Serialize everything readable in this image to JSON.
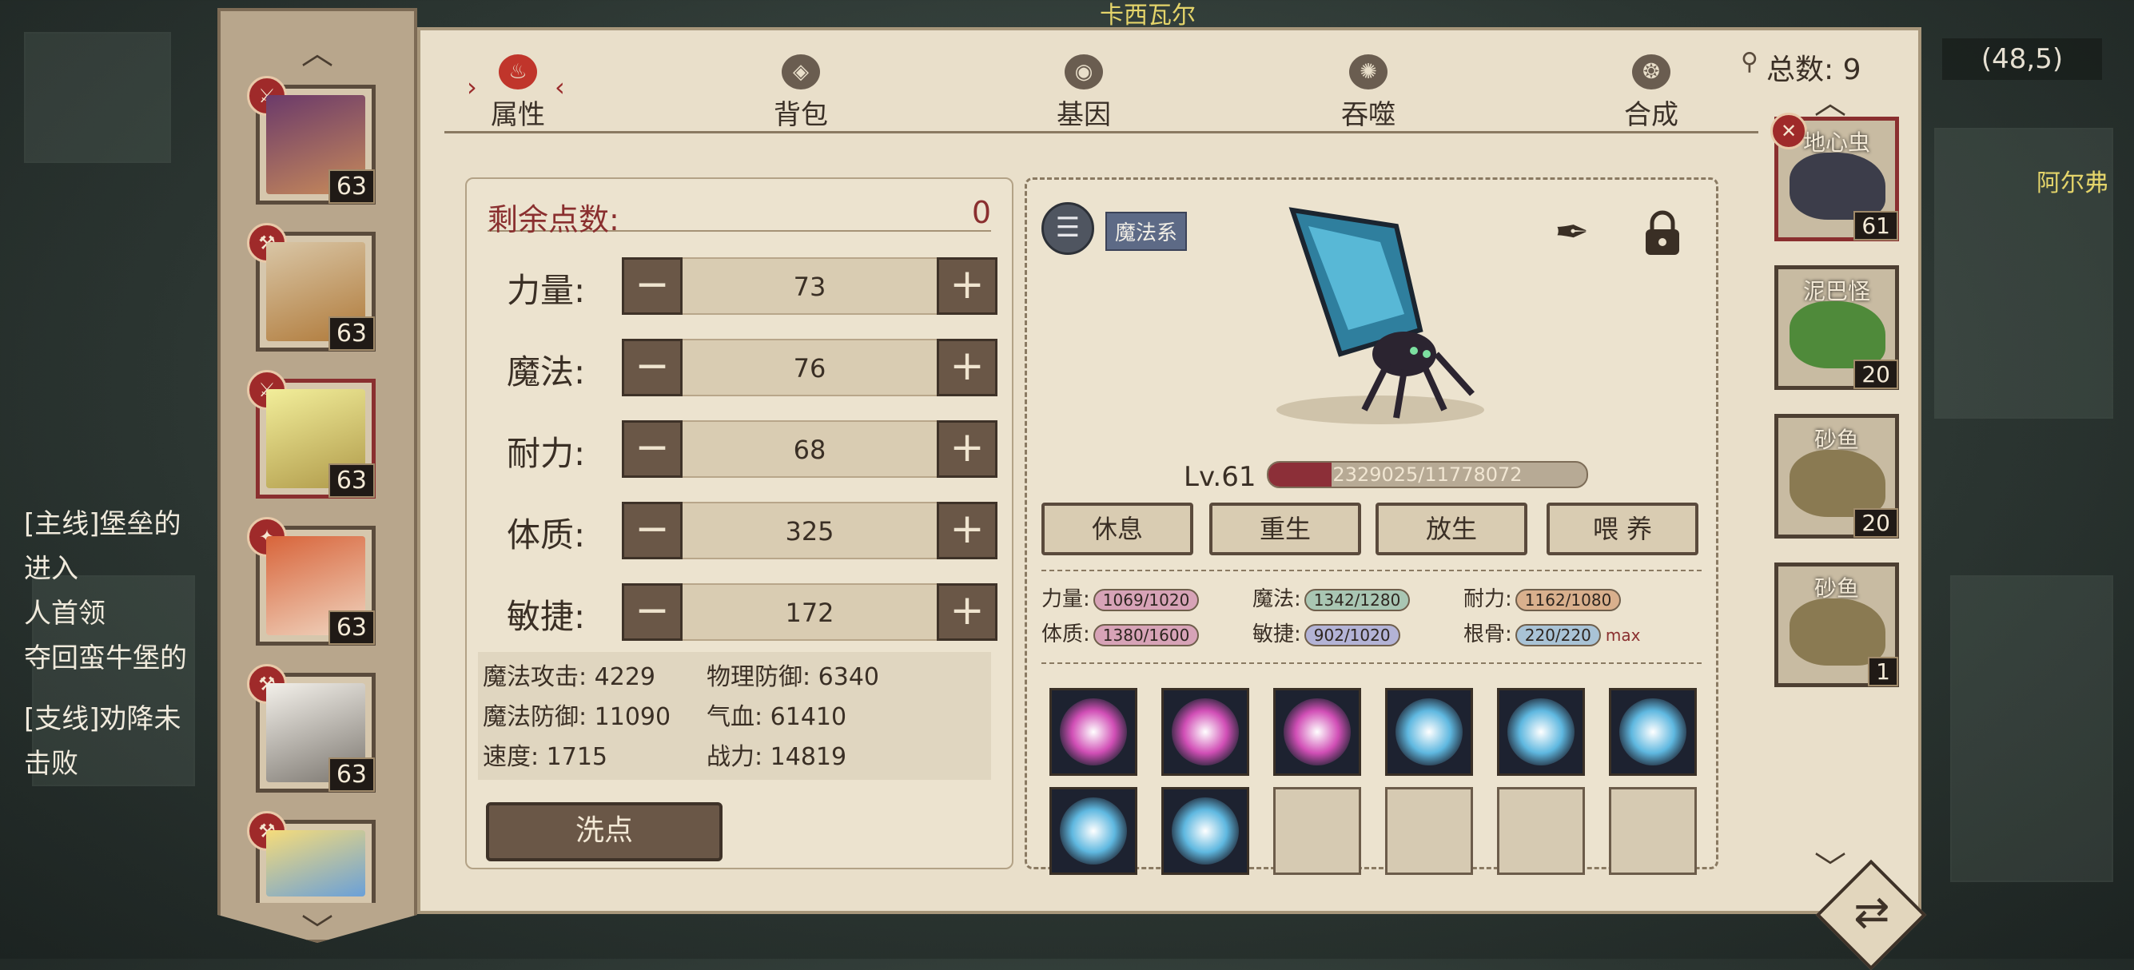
{
  "background": {
    "top_name": "卡西瓦尔",
    "right_name": "阿尔弗",
    "chat_lines": [
      "[主线]堡垒的",
      "进入",
      "人首领",
      "夺回蛮牛堡的",
      "[支线]劝降未",
      "击败"
    ]
  },
  "header": {
    "total_label": "总数: 9",
    "coords": "(48,5)"
  },
  "tabs": [
    {
      "label": "属性",
      "icon": "flame-icon",
      "active": true
    },
    {
      "label": "背包",
      "icon": "bag-icon",
      "active": false
    },
    {
      "label": "基因",
      "icon": "gene-icon",
      "active": false
    },
    {
      "label": "吞噬",
      "icon": "devour-icon",
      "active": false
    },
    {
      "label": "合成",
      "icon": "fuse-icon",
      "active": false
    }
  ],
  "characters": [
    {
      "level": "63",
      "selected": false,
      "color": "#6b3a6a"
    },
    {
      "level": "63",
      "selected": false,
      "color": "#b07a3a"
    },
    {
      "level": "63",
      "selected": true,
      "color": "#e3d04a"
    },
    {
      "level": "63",
      "selected": false,
      "color": "#d8643a"
    },
    {
      "level": "63",
      "selected": false,
      "color": "#c9c4bc"
    },
    {
      "level": "",
      "selected": false,
      "color": "#e6c34a"
    }
  ],
  "points": {
    "label": "剩余点数:",
    "value": "0",
    "stats": [
      {
        "name": "力量:",
        "value": "73"
      },
      {
        "name": "魔法:",
        "value": "76"
      },
      {
        "name": "耐力:",
        "value": "68"
      },
      {
        "name": "体质:",
        "value": "325"
      },
      {
        "name": "敏捷:",
        "value": "172"
      }
    ],
    "derived": [
      "魔法攻击: 4229",
      "物理防御: 6340",
      "魔法防御: 11090",
      "气血: 61410",
      "速度: 1715",
      "战力: 14819"
    ],
    "reset_label": "洗点"
  },
  "pet": {
    "element": "魔法系",
    "level": "Lv.61",
    "exp_text": "2329025/11778072",
    "exp_fraction": 0.198,
    "actions": [
      "休息",
      "重生",
      "放生",
      "喂 养"
    ],
    "aptitudes": [
      {
        "name": "力量:",
        "value": "1069/1020",
        "color": "#d7a3b7"
      },
      {
        "name": "魔法:",
        "value": "1342/1280",
        "color": "#a9c6b3"
      },
      {
        "name": "耐力:",
        "value": "1162/1080",
        "color": "#d9b08d"
      },
      {
        "name": "体质:",
        "value": "1380/1600",
        "color": "#d7a3b7"
      },
      {
        "name": "敏捷:",
        "value": "902/1020",
        "color": "#b3b3d6"
      },
      {
        "name": "根骨:",
        "value": "220/220",
        "color": "#a9c3d6"
      }
    ],
    "max_text": "max",
    "skills": [
      {
        "icon": "pink-warrior-skill-icon",
        "color": "#d14fb6"
      },
      {
        "icon": "pink-shield-skill-icon",
        "color": "#d14fb6"
      },
      {
        "icon": "pink-vortex-skill-icon",
        "color": "#d14fb6"
      },
      {
        "icon": "blue-shatter-skill-icon",
        "color": "#5fb8e0"
      },
      {
        "icon": "blue-guardian-skill-icon",
        "color": "#5fb8e0"
      },
      {
        "icon": "blue-swirl-skill-icon",
        "color": "#5fb8e0"
      },
      {
        "icon": "blue-rune-skill-icon",
        "color": "#5fb8e0"
      },
      {
        "icon": "blue-spiral-skill-icon",
        "color": "#5fb8e0"
      },
      {
        "icon": "",
        "color": ""
      },
      {
        "icon": "",
        "color": ""
      },
      {
        "icon": "",
        "color": ""
      },
      {
        "icon": "",
        "color": ""
      }
    ]
  },
  "pet_list": [
    {
      "name": "地心虫",
      "level": "61",
      "selected": true,
      "color": "#3c3d4a"
    },
    {
      "name": "泥巴怪",
      "level": "20",
      "selected": false,
      "color": "#4f8a3a"
    },
    {
      "name": "砂鱼",
      "level": "20",
      "selected": false,
      "color": "#8a7a52"
    },
    {
      "name": "砂鱼",
      "level": "1",
      "selected": false,
      "color": "#8a7a52"
    }
  ]
}
